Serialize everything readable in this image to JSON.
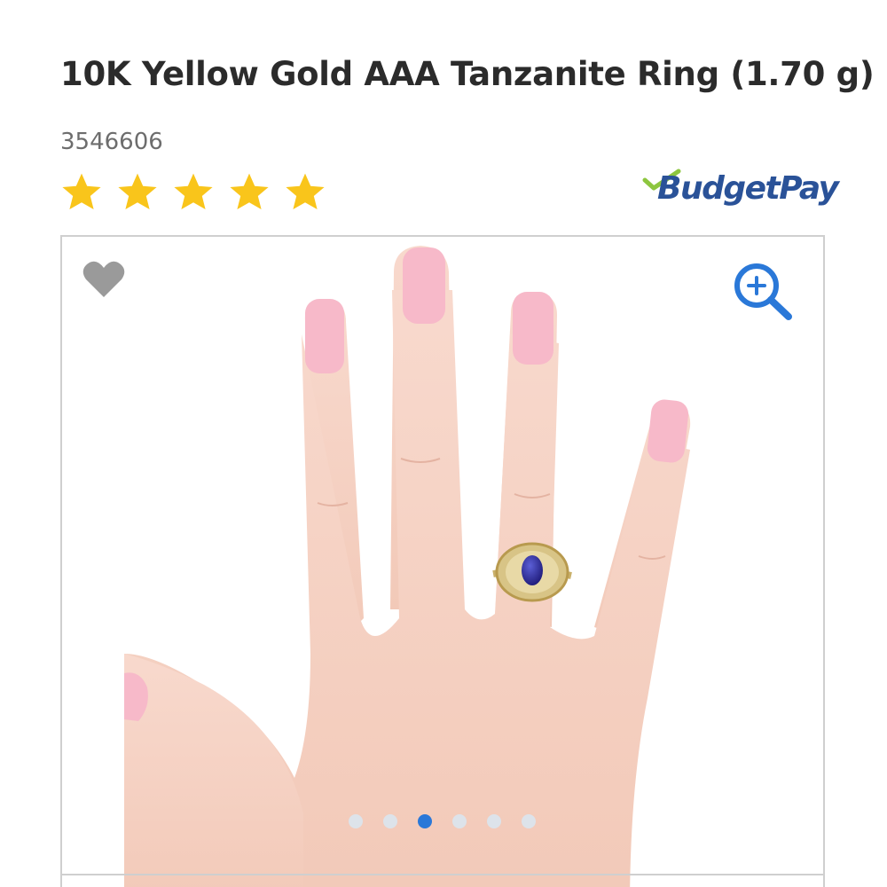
{
  "product": {
    "title": "10K Yellow Gold AAA Tanzanite Ring (1.70 g)",
    "sku": "3546606",
    "rating": {
      "value": 5,
      "max": 5
    }
  },
  "badges": {
    "budgetpay": {
      "label": "BudgetPay"
    }
  },
  "gallery": {
    "wishlist_icon": "heart-icon",
    "zoom_icon": "zoom-in-icon",
    "slide_count": 6,
    "active_slide_index": 2
  },
  "colors": {
    "star": "#f9c51b",
    "budgetpay_text": "#2a5298",
    "budgetpay_check": "#8dc63f",
    "zoom_icon": "#2a78d8",
    "active_dot": "#2a78d8",
    "heart": "#9a9a9a"
  }
}
